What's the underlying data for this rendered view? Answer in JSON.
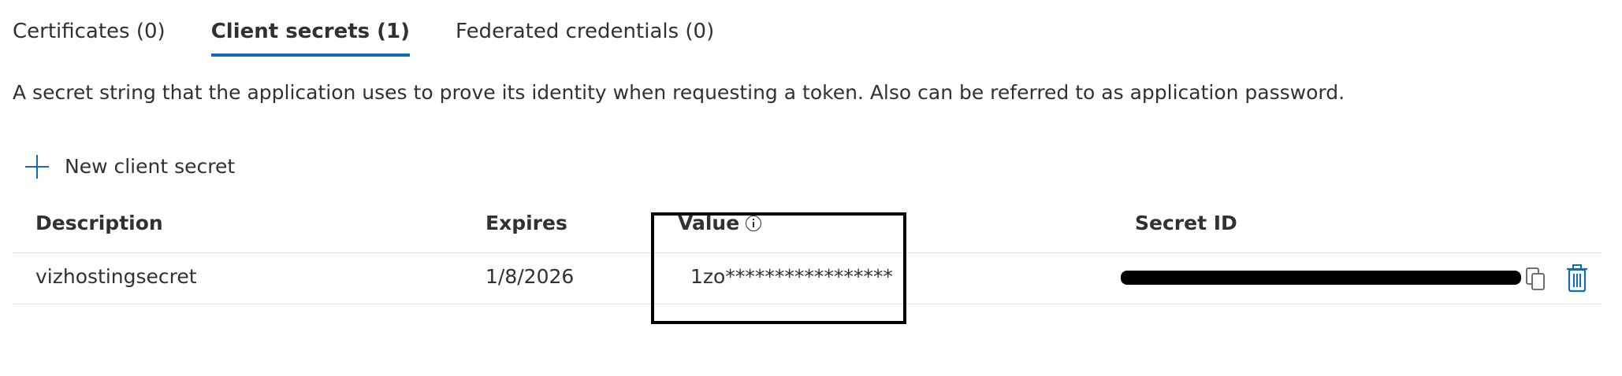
{
  "tabs": [
    {
      "label": "Certificates (0)",
      "active": false
    },
    {
      "label": "Client secrets (1)",
      "active": true
    },
    {
      "label": "Federated credentials (0)",
      "active": false
    }
  ],
  "description": "A secret string that the application uses to prove its identity when requesting a token. Also can be referred to as application password.",
  "actions": {
    "new_secret_label": "New client secret",
    "new_secret_icon": "plus-icon"
  },
  "table": {
    "headers": {
      "description": "Description",
      "expires": "Expires",
      "value": "Value",
      "secret_id": "Secret ID"
    },
    "rows": [
      {
        "description": "vizhostingsecret",
        "expires": "1/8/2026",
        "value": "1zo*****************",
        "secret_id_redacted": true
      }
    ]
  },
  "icons": {
    "info": "info-icon",
    "copy": "copy-icon",
    "delete": "delete-icon"
  },
  "colors": {
    "accent": "#0f6cbd",
    "text": "#323130",
    "divider": "#e1dfdd",
    "highlight_box": "#000000",
    "redaction": "#000000"
  }
}
